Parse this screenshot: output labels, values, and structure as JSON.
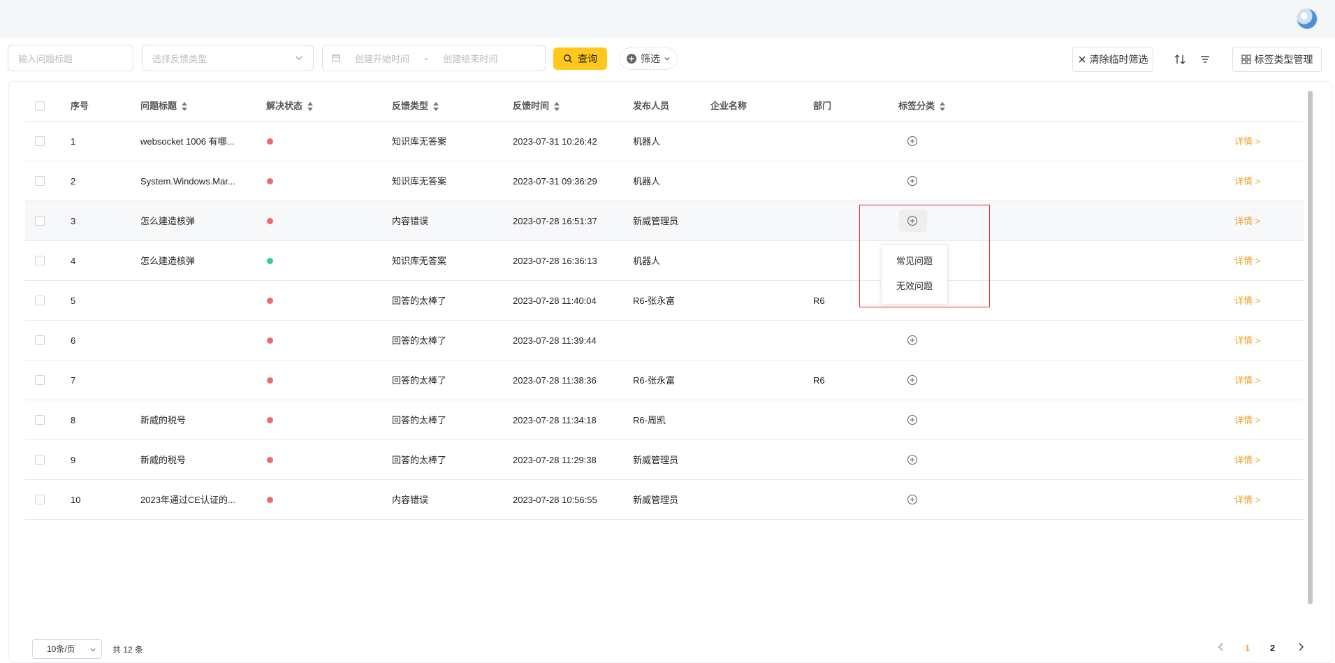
{
  "toolbar": {
    "problem_title_placeholder": "输入问题标题",
    "feedback_type_placeholder": "选择反馈类型",
    "start_date_placeholder": "创建开始时间",
    "date_separator": "-",
    "end_date_placeholder": "创建结束时间",
    "query_label": "查询",
    "filter_label": "筛选",
    "clear_filters_label": "清除临时筛选",
    "tag_type_manage_label": "标签类型管理"
  },
  "table": {
    "headers": {
      "index": "序号",
      "title": "问题标题",
      "status": "解决状态",
      "feedback_type": "反馈类型",
      "feedback_time": "反馈时间",
      "publisher": "发布人员",
      "company": "企业名称",
      "department": "部门",
      "tag_category": "标签分类"
    },
    "rows": [
      {
        "index": "1",
        "title": "websocket 1006 有哪...",
        "status_color": "#ef6b6b",
        "feedback_type": "知识库无答案",
        "feedback_time": "2023-07-31 10:26:42",
        "publisher": "机器人",
        "company": "",
        "department": "",
        "detail": "详情 >"
      },
      {
        "index": "2",
        "title": "System.Windows.Mar...",
        "status_color": "#ef6b6b",
        "feedback_type": "知识库无答案",
        "feedback_time": "2023-07-31 09:36:29",
        "publisher": "机器人",
        "company": "",
        "department": "",
        "detail": "详情 >"
      },
      {
        "index": "3",
        "title": "怎么建造核弹",
        "status_color": "#ef6b6b",
        "feedback_type": "内容错误",
        "feedback_time": "2023-07-28 16:51:37",
        "publisher": "新威管理员",
        "company": "",
        "department": "",
        "detail": "详情 >"
      },
      {
        "index": "4",
        "title": "怎么建造核弹",
        "status_color": "#34c7a5",
        "feedback_type": "知识库无答案",
        "feedback_time": "2023-07-28 16:36:13",
        "publisher": "机器人",
        "company": "",
        "department": "",
        "detail": "详情 >"
      },
      {
        "index": "5",
        "title": "",
        "status_color": "#ef6b6b",
        "feedback_type": "回答的太棒了",
        "feedback_time": "2023-07-28 11:40:04",
        "publisher": "R6-张永富",
        "company": "",
        "department": "R6",
        "detail": "详情 >"
      },
      {
        "index": "6",
        "title": "",
        "status_color": "#ef6b6b",
        "feedback_type": "回答的太棒了",
        "feedback_time": "2023-07-28 11:39:44",
        "publisher": "",
        "company": "",
        "department": "",
        "detail": "详情 >"
      },
      {
        "index": "7",
        "title": "",
        "status_color": "#ef6b6b",
        "feedback_type": "回答的太棒了",
        "feedback_time": "2023-07-28 11:38:36",
        "publisher": "R6-张永富",
        "company": "",
        "department": "R6",
        "detail": "详情 >"
      },
      {
        "index": "8",
        "title": "新威的税号",
        "status_color": "#ef6b6b",
        "feedback_type": "回答的太棒了",
        "feedback_time": "2023-07-28 11:34:18",
        "publisher": "R6-周凯",
        "company": "",
        "department": "",
        "detail": "详情 >"
      },
      {
        "index": "9",
        "title": "新威的税号",
        "status_color": "#ef6b6b",
        "feedback_type": "回答的太棒了",
        "feedback_time": "2023-07-28 11:29:38",
        "publisher": "新威管理员",
        "company": "",
        "department": "",
        "detail": "详情 >"
      },
      {
        "index": "10",
        "title": "2023年通过CE认证的...",
        "status_color": "#ef6b6b",
        "feedback_type": "内容错误",
        "feedback_time": "2023-07-28 10:56:55",
        "publisher": "新威管理员",
        "company": "",
        "department": "",
        "detail": "详情 >"
      }
    ]
  },
  "tag_dropdown": {
    "items": [
      "常见问题",
      "无效问题"
    ]
  },
  "pagination": {
    "page_size": "10条/页",
    "total": "共 12 条",
    "current_page": "1",
    "next_page": "2"
  },
  "icons": {
    "prev": "chevron-left-icon",
    "next": "chevron-right-icon",
    "add_tag": "plus-circle-icon"
  }
}
